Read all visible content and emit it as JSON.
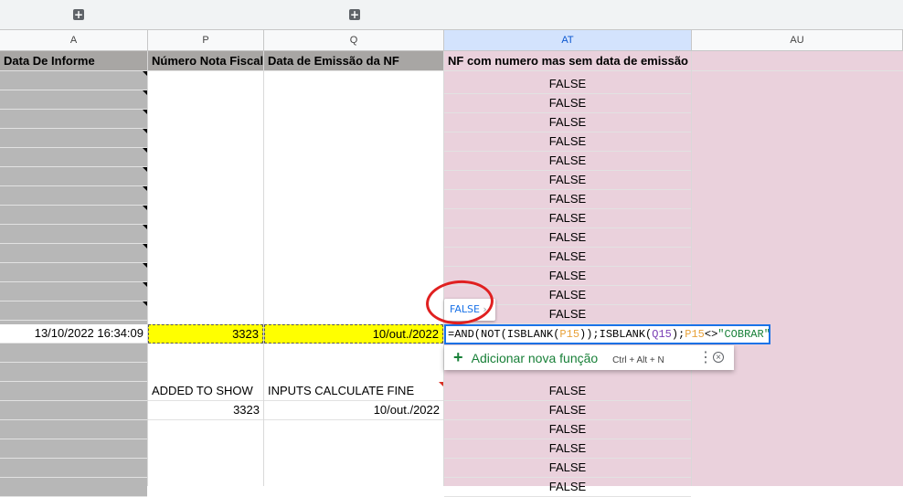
{
  "column_headers": {
    "a": "A",
    "p": "P",
    "q": "Q",
    "at": "AT",
    "au": "AU"
  },
  "header_row": {
    "a": "Data De Informe",
    "p": "Número Nota Fiscal",
    "q": "Data de Emissão da NF",
    "at": "NF com numero mas sem data de emissão"
  },
  "false_value": "FALSE",
  "row15": {
    "a": "13/10/2022 16:34:09",
    "p": "3323",
    "q": "10/out./2022"
  },
  "row18": {
    "p": "ADDED TO SHOW",
    "q": "INPUTS CALCULATE FINE"
  },
  "row19": {
    "p": "3323",
    "q": "10/out./2022"
  },
  "tooltip_value": "FALSE",
  "formula": {
    "t1": "=AND(NOT(ISBLANK(",
    "t2": "P15",
    "t3": "));ISBLANK(",
    "t4": "Q15",
    "t5": ");",
    "t6": "P15",
    "t7": "<>",
    "t8": "\"COBRAR\"",
    "t9": ")"
  },
  "suggestion": {
    "label": "Adicionar nova função",
    "shortcut": "Ctrl + Alt + N"
  },
  "colors": {
    "selected_range": "#ffff00",
    "pink_fill": "#ead1dc",
    "gray_fill": "#b7b7b7",
    "accent": "#1a73e8"
  }
}
